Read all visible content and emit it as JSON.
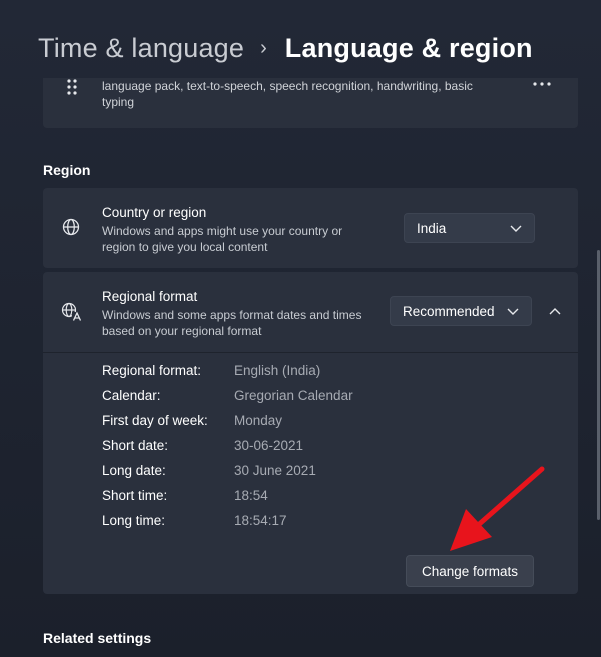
{
  "header": {
    "parent": "Time & language",
    "current": "Language & region"
  },
  "language_card": {
    "description": "language pack, text-to-speech, speech recognition, handwriting, basic typing"
  },
  "region": {
    "section_label": "Region",
    "country": {
      "title": "Country or region",
      "description": "Windows and apps might use your country or region to give you local content",
      "selected": "India"
    },
    "regional_format": {
      "title": "Regional format",
      "description": "Windows and some apps format dates and times based on your regional format",
      "selected": "Recommended",
      "details": [
        {
          "key": "Regional format:",
          "value": "English (India)"
        },
        {
          "key": "Calendar:",
          "value": "Gregorian Calendar"
        },
        {
          "key": "First day of week:",
          "value": "Monday"
        },
        {
          "key": "Short date:",
          "value": "30-06-2021"
        },
        {
          "key": "Long date:",
          "value": "30 June 2021"
        },
        {
          "key": "Short time:",
          "value": "18:54"
        },
        {
          "key": "Long time:",
          "value": "18:54:17"
        }
      ],
      "change_button": "Change formats"
    }
  },
  "related": {
    "section_label": "Related settings"
  },
  "colors": {
    "background": "#1d2330",
    "card": "#2a303d",
    "annotation_arrow": "#e8141c"
  },
  "icons": [
    "drag-handle-icon",
    "more-options-icon",
    "globe-icon",
    "language-icon",
    "chevron-down-icon",
    "chevron-up-icon"
  ]
}
